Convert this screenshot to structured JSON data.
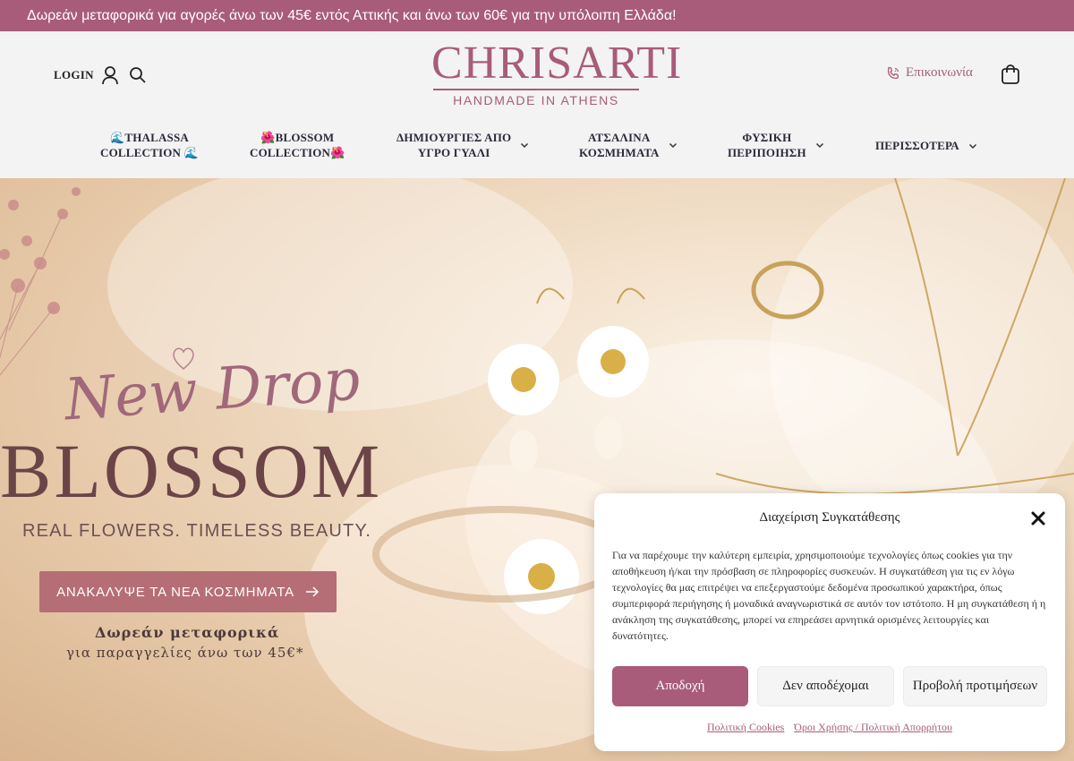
{
  "announcement": "Δωρεάν μεταφορικά για αγορές άνω των 45€ εντός Αττικής και άνω των 60€ για την υπόλοιπη Ελλάδα!",
  "header": {
    "login_label": "LOGIN",
    "logo_text": "CHRISARTI",
    "logo_tagline": "HANDMADE IN ATHENS",
    "contact_label": "Επικοινωνία"
  },
  "nav": {
    "items": [
      {
        "line1": "🌊THALASSA",
        "line2": "COLLECTION 🌊",
        "has_dropdown": false
      },
      {
        "line1": "🌺BLOSSOM",
        "line2": "COLLECTION🌺",
        "has_dropdown": false
      },
      {
        "line1": "ΔΗΜΙΟΥΡΓΙΕΣ ΑΠΟ",
        "line2": "ΥΓΡΟ ΓΥΑΛΙ",
        "has_dropdown": true
      },
      {
        "line1": "ΑΤΣΑΛΙΝΑ",
        "line2": "ΚΟΣΜΗΜΑΤΑ",
        "has_dropdown": true
      },
      {
        "line1": "ΦΥΣΙΚΗ",
        "line2": "ΠΕΡΙΠΟΙΗΣΗ",
        "has_dropdown": true
      },
      {
        "line1": "ΠΕΡΙΣΣΟΤΕΡΑ",
        "line2": "",
        "has_dropdown": true
      }
    ]
  },
  "hero": {
    "script_title": "New Drop",
    "title": "BLOSSOM",
    "tagline": "REAL FLOWERS. TIMELESS BEAUTY.",
    "cta_label": "ΑΝΑΚΑΛΥΨΕ ΤΑ ΝΕΑ ΚΟΣΜΗΜΑΤΑ",
    "free_shipping_line1": "Δωρεάν μεταφορικά",
    "free_shipping_line2": "για παραγγελίες άνω των 45€*"
  },
  "consent": {
    "title": "Διαχείριση Συγκατάθεσης",
    "body": "Για να παρέχουμε την καλύτερη εμπειρία, χρησιμοποιούμε τεχνολογίες όπως cookies για την αποθήκευση ή/και την πρόσβαση σε πληροφορίες συσκευών. Η συγκατάθεση για τις εν λόγω τεχνολογίες θα μας επιτρέψει να επεξεργαστούμε δεδομένα προσωπικού χαρακτήρα, όπως συμπεριφορά περιήγησης ή μοναδικά αναγνωριστικά σε αυτόν τον ιστότοπο. Η μη συγκατάθεση ή η ανάκληση της συγκατάθεσης, μπορεί να επηρεάσει αρνητικά ορισμένες λειτουργίες και δυνατότητες.",
    "accept_label": "Αποδοχή",
    "deny_label": "Δεν αποδέχομαι",
    "prefs_label": "Προβολή προτιμήσεων",
    "link_cookies": "Πολιτική Cookies",
    "link_terms": "Όροι Χρήσης / Πολιτική Απορρήτου"
  },
  "colors": {
    "brand": "#a85c79",
    "cta": "#b56e76",
    "title": "#6b4448"
  }
}
